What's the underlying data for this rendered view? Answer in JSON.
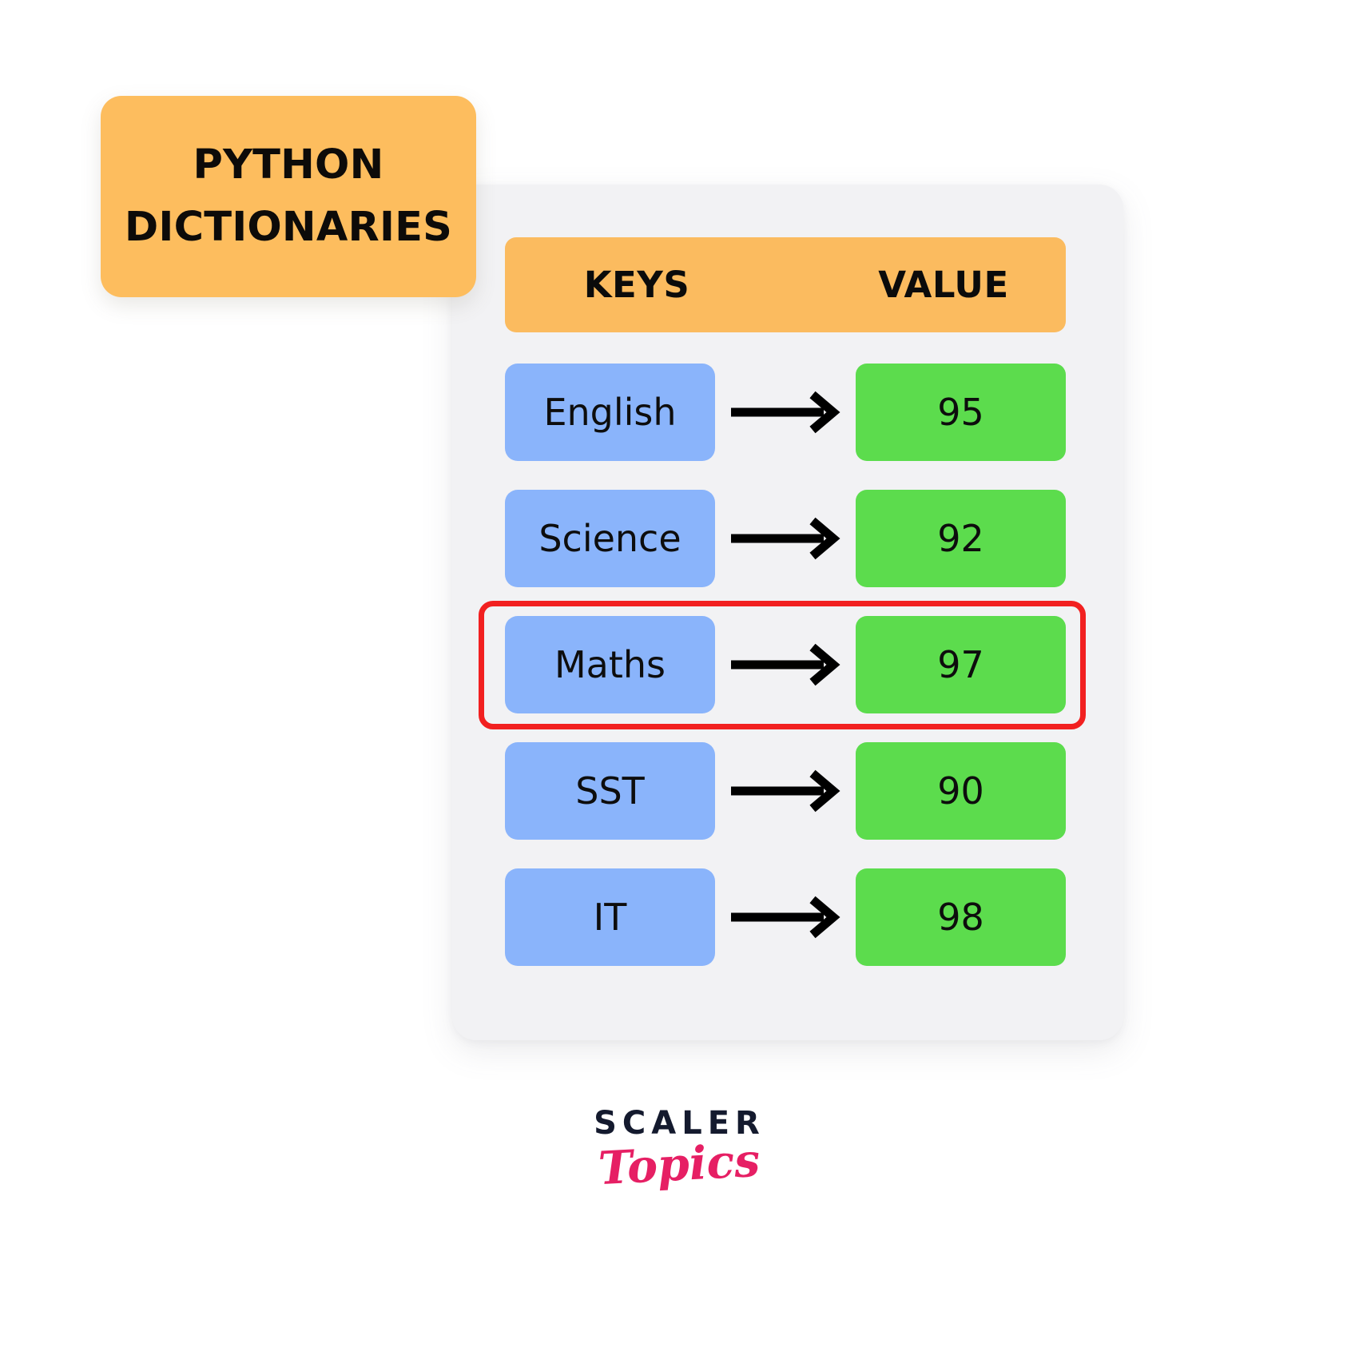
{
  "title_badge": {
    "text": "PYTHON\nDICTIONARIES"
  },
  "card": {
    "header": {
      "keys_label": "KEYS",
      "value_label": "VALUE"
    },
    "rows": [
      {
        "key": "English",
        "value": "95",
        "arrow": "arrow-right-icon",
        "highlighted": false
      },
      {
        "key": "Science",
        "value": "92",
        "arrow": "arrow-right-icon",
        "highlighted": false
      },
      {
        "key": "Maths",
        "value": "97",
        "arrow": "arrow-right-icon",
        "highlighted": true
      },
      {
        "key": "SST",
        "value": "90",
        "arrow": "arrow-right-icon",
        "highlighted": false
      },
      {
        "key": "IT",
        "value": "98",
        "arrow": "arrow-right-icon",
        "highlighted": false
      }
    ]
  },
  "logo": {
    "primary": "SCALER",
    "secondary": "Topics"
  },
  "colors": {
    "background": "#ffffff",
    "card": "#f2f2f4",
    "accent_orange": "#fdbd5e",
    "header_orange": "#fbbb5f",
    "key_blue": "#8ab4fb",
    "value_green": "#5cdc4d",
    "highlight_red": "#f22020",
    "logo_navy": "#141a2e",
    "logo_pink": "#e61f64",
    "text_black": "#0d0d0d"
  }
}
